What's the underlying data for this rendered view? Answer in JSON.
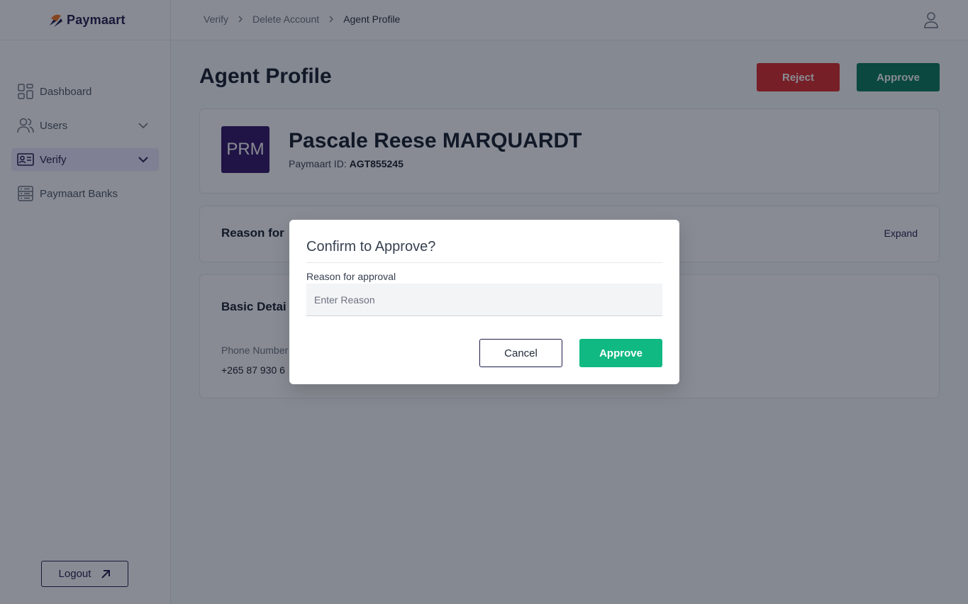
{
  "app": {
    "name": "Paymaart"
  },
  "sidebar": {
    "items": [
      {
        "label": "Dashboard",
        "icon": "dashboard-icon",
        "expandable": false,
        "active": false
      },
      {
        "label": "Users",
        "icon": "users-icon",
        "expandable": true,
        "active": false
      },
      {
        "label": "Verify",
        "icon": "id-card-icon",
        "expandable": true,
        "active": true
      },
      {
        "label": "Paymaart Banks",
        "icon": "bank-list-icon",
        "expandable": false,
        "active": false
      }
    ],
    "logout_label": "Logout"
  },
  "breadcrumb": [
    "Verify",
    "Delete Account",
    "Agent Profile"
  ],
  "page": {
    "title": "Agent Profile",
    "reject_label": "Reject",
    "approve_label": "Approve"
  },
  "profile": {
    "initials": "PRM",
    "name": "Pascale Reese MARQUARDT",
    "id_label": "Paymaart ID:",
    "id_value": "AGT855245"
  },
  "reason_card": {
    "heading": "Reason for",
    "expand_label": "Expand"
  },
  "basic_details": {
    "heading": "Basic Detai",
    "phone_label": "Phone Number",
    "phone_value": "+265 87 930 6"
  },
  "modal": {
    "title": "Confirm to Approve?",
    "reason_label": "Reason for approval",
    "reason_placeholder": "Enter Reason",
    "cancel_label": "Cancel",
    "approve_label": "Approve"
  },
  "colors": {
    "brand": "#1e1b4b",
    "reject": "#dc2626",
    "approve": "#047857",
    "approve_modal": "#10b981",
    "avatar": "#2e1065"
  }
}
